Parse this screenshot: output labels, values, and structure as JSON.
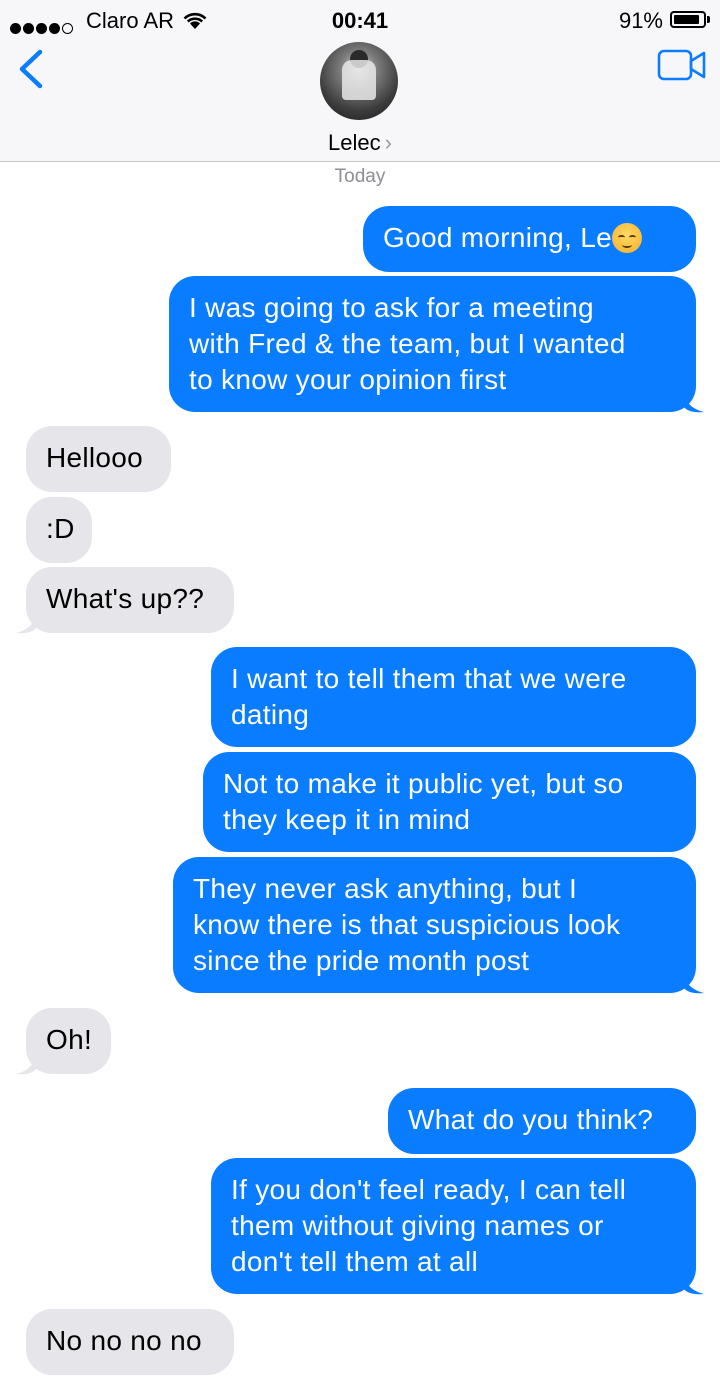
{
  "status_bar": {
    "carrier": "Claro AR",
    "time": "00:41",
    "battery_percent": "91%",
    "battery_level": 0.91
  },
  "header": {
    "contact_name": "Lelec",
    "chevron": "›"
  },
  "day_label": "Today",
  "messages": [
    {
      "dir": "out",
      "text": "Good morning, Le",
      "emoji": "smiling-face-icon"
    },
    {
      "dir": "out",
      "lines": [
        "I was going to ask for a meeting",
        "with Fred & the team, but I wanted",
        "to know your opinion first"
      ]
    },
    {
      "dir": "in",
      "text": "Hellooo"
    },
    {
      "dir": "in",
      "text": ":D"
    },
    {
      "dir": "in",
      "text": "What's up??"
    },
    {
      "dir": "out",
      "lines": [
        "I want to tell them that we were",
        "dating"
      ]
    },
    {
      "dir": "out",
      "lines": [
        "Not to make it public yet, but so",
        "they keep it in mind"
      ]
    },
    {
      "dir": "out",
      "lines": [
        "They never ask anything, but I",
        "know there is that suspicious look",
        "since the pride month post"
      ]
    },
    {
      "dir": "in",
      "text": "Oh!"
    },
    {
      "dir": "out",
      "text": "What do you think?"
    },
    {
      "dir": "out",
      "lines": [
        "If you don't feel ready, I can tell",
        "them without giving names or",
        "don't tell them at all"
      ]
    },
    {
      "dir": "in",
      "text": "No no no no"
    }
  ],
  "colors": {
    "outgoing_bubble": "#0a7cff",
    "incoming_bubble": "#e5e5ea",
    "accent": "#0a7cff"
  }
}
